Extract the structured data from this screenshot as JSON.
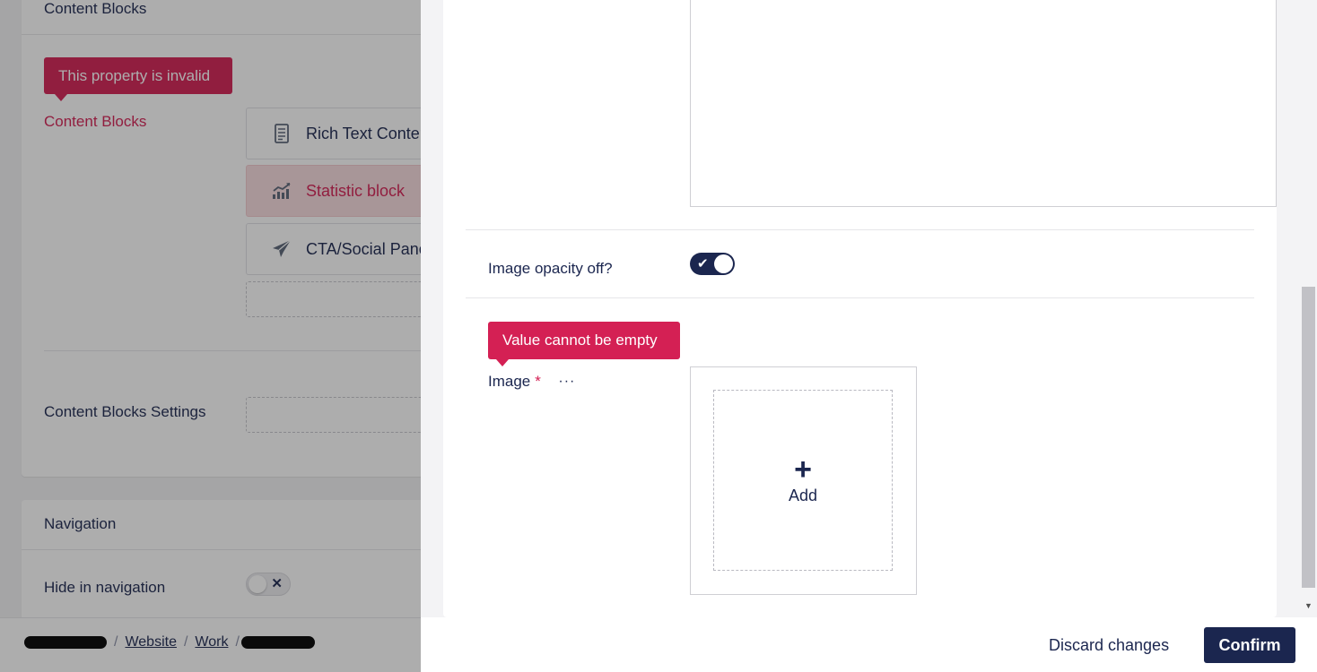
{
  "background": {
    "content_card": {
      "header": "Content Blocks",
      "invalid_tooltip": "This property is invalid",
      "property_label": "Content Blocks",
      "blocks": [
        {
          "label": "Rich Text Content",
          "icon": "document-icon",
          "active": false
        },
        {
          "label": "Statistic block",
          "icon": "chart-icon",
          "active": true
        },
        {
          "label": "CTA/Social Panel",
          "icon": "paper-plane-icon",
          "active": false
        }
      ],
      "settings_label": "Content Blocks Settings"
    },
    "navigation_card": {
      "header": "Navigation",
      "hide_label": "Hide in navigation",
      "toggle_symbol": "✕"
    },
    "breadcrumb": {
      "items": [
        "Website",
        "Work"
      ],
      "separator": "/"
    }
  },
  "dialog": {
    "opacity_label": "Image opacity off?",
    "opacity_toggle_symbol": "✔",
    "error_tooltip": "Value cannot be empty",
    "image_label": "Image",
    "required_mark": "*",
    "more_symbol": "···",
    "add_symbol": "+",
    "add_label": "Add",
    "scroll_down_symbol": "▼",
    "discard_label": "Discard changes",
    "confirm_label": "Confirm"
  },
  "colors": {
    "primary": "#1b264f",
    "danger": "#d42054",
    "active_block_bg": "#f8dcdf"
  }
}
